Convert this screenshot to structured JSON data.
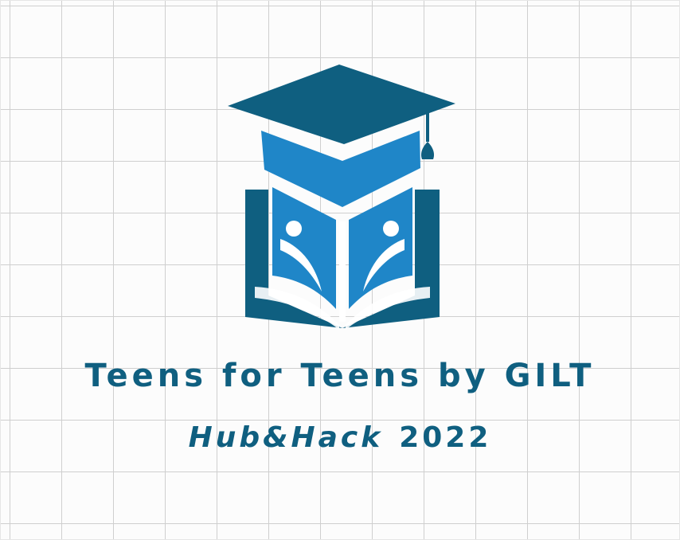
{
  "logo": {
    "icon": "graduation-cap-book-readers-icon",
    "colors": {
      "dark_blue": "#0f5f80",
      "bright_blue": "#1f86c8",
      "background": "#fcfcfc",
      "grid": "#cfcfcf"
    },
    "title": "Teens for Teens by GILT",
    "event_name": "Hub&Hack",
    "year": "2022"
  }
}
